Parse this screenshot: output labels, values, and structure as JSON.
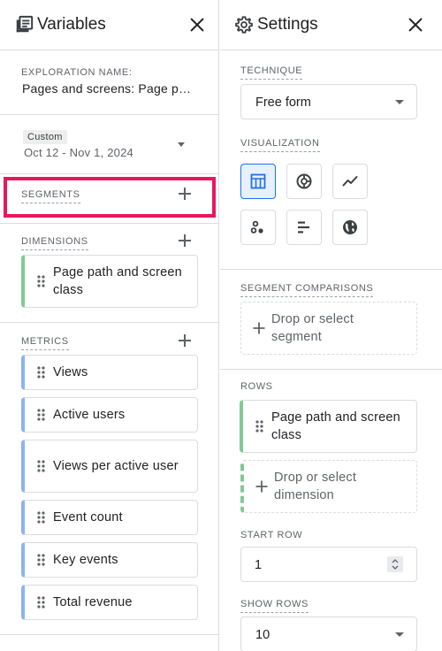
{
  "variables": {
    "title": "Variables",
    "exploration_name_label": "EXPLORATION NAME:",
    "exploration_name": "Pages and screens: Page p…",
    "date_badge": "Custom",
    "date_range": "Oct 12 - Nov 1, 2024",
    "segments_label": "SEGMENTS",
    "dimensions_label": "DIMENSIONS",
    "dimensions": [
      "Page path and screen class"
    ],
    "metrics_label": "METRICS",
    "metrics": [
      "Views",
      "Active users",
      "Views per active user",
      "Event count",
      "Key events",
      "Total revenue"
    ]
  },
  "settings": {
    "title": "Settings",
    "technique_label": "TECHNIQUE",
    "technique_value": "Free form",
    "visualization_label": "VISUALIZATION",
    "visualizations": [
      {
        "icon": "table-icon",
        "selected": true
      },
      {
        "icon": "donut-chart-icon",
        "selected": false
      },
      {
        "icon": "line-chart-icon",
        "selected": false
      },
      {
        "icon": "scatter-plot-icon",
        "selected": false
      },
      {
        "icon": "bar-chart-icon",
        "selected": false
      },
      {
        "icon": "globe-icon",
        "selected": false
      }
    ],
    "segment_comparisons_label": "SEGMENT COMPARISONS",
    "segment_drop_text": "Drop or select segment",
    "rows_label": "ROWS",
    "rows_item": "Page path and screen class",
    "rows_drop_text": "Drop or select dimension",
    "start_row_label": "START ROW",
    "start_row_value": "1",
    "show_rows_label": "SHOW ROWS",
    "show_rows_value": "10"
  },
  "colors": {
    "accent": "#1a73e8",
    "dimension_bar": "#81c995",
    "metric_bar": "#8ab4f8",
    "highlight": "#e8175d"
  }
}
